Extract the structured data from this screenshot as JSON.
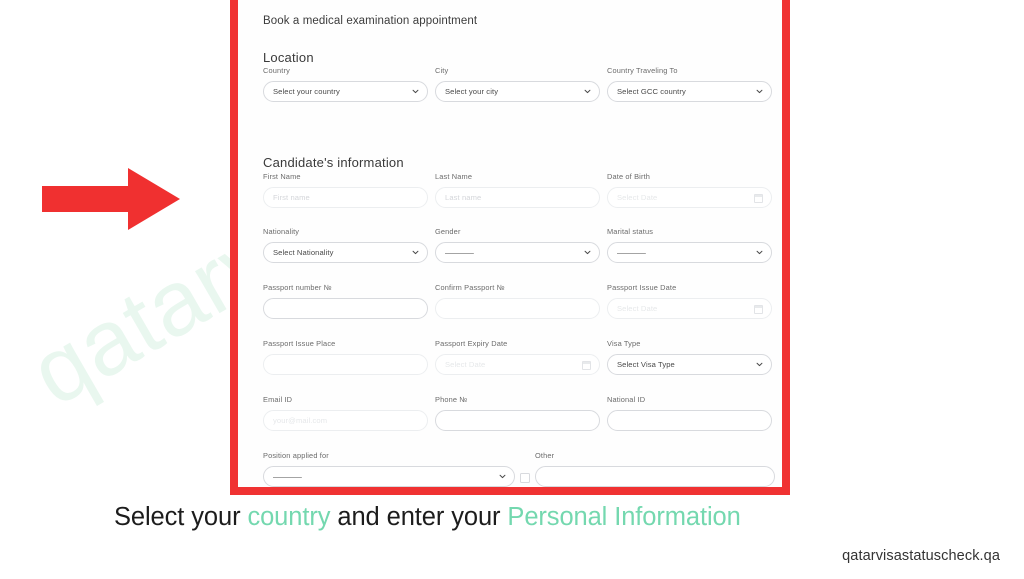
{
  "watermark": "qatarvisastatuscheck.qa",
  "form": {
    "title": "Book a medical examination appointment",
    "location": {
      "heading": "Location",
      "fields": [
        {
          "label": "Country",
          "value": "Select your country",
          "type": "select"
        },
        {
          "label": "City",
          "value": "Select your city",
          "type": "select"
        },
        {
          "label": "Country Traveling To",
          "value": "Select GCC country",
          "type": "select"
        }
      ]
    },
    "candidate": {
      "heading": "Candidate's information",
      "row1": [
        {
          "label": "First Name",
          "placeholder": "First name",
          "type": "text"
        },
        {
          "label": "Last Name",
          "placeholder": "Last name",
          "type": "text"
        },
        {
          "label": "Date of Birth",
          "placeholder": "Select Date",
          "type": "date"
        }
      ],
      "row2": [
        {
          "label": "Nationality",
          "value": "Select Nationality",
          "type": "select"
        },
        {
          "label": "Gender",
          "value": "————",
          "type": "select"
        },
        {
          "label": "Marital status",
          "value": "————",
          "type": "select"
        }
      ],
      "row3": [
        {
          "label": "Passport number №",
          "placeholder": "",
          "type": "text"
        },
        {
          "label": "Confirm Passport №",
          "placeholder": "",
          "type": "text"
        },
        {
          "label": "Passport Issue Date",
          "placeholder": "Select Date",
          "type": "date"
        }
      ],
      "row4": [
        {
          "label": "Passport Issue Place",
          "placeholder": "",
          "type": "text"
        },
        {
          "label": "Passport Expiry Date",
          "placeholder": "Select Date",
          "type": "date"
        },
        {
          "label": "Visa Type",
          "value": "Select Visa Type",
          "type": "select"
        }
      ],
      "row5": [
        {
          "label": "Email ID",
          "placeholder": "your@mail.com",
          "type": "text"
        },
        {
          "label": "Phone №",
          "placeholder": "",
          "type": "text"
        },
        {
          "label": "National ID",
          "placeholder": "",
          "type": "text"
        }
      ],
      "row6": {
        "position": {
          "label": "Position applied for",
          "value": "————",
          "type": "select"
        },
        "other": {
          "label": "Other",
          "placeholder": "",
          "type": "text",
          "checkbox": false
        }
      }
    }
  },
  "caption": {
    "part1": "Select your ",
    "highlight1": "country",
    "part2": " and enter your ",
    "highlight2": "Personal Information"
  },
  "site_credit": "qatarvisastatuscheck.qa",
  "colors": {
    "frame_red": "#f03232",
    "arrow_red": "#f03030",
    "accent_green": "#74d8af",
    "watermark_green": "#e9f7ef"
  }
}
